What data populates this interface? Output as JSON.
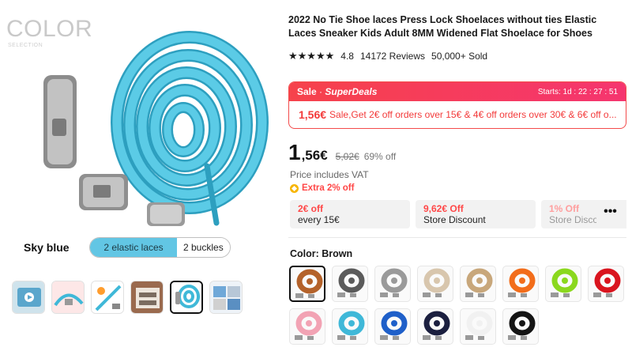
{
  "gallery": {
    "watermark_title": "COLOR",
    "watermark_sub": "SELECTION",
    "color_name": "Sky blue",
    "option_a": "2 elastic laces",
    "option_b": "2 buckles",
    "lace_color": "#40b9d8",
    "selected_thumb_index": 4
  },
  "product": {
    "title": "2022 No Tie Shoe laces Press Lock Shoelaces without ties Elastic Laces Sneaker Kids Adult 8MM Widened Flat Shoelace for Shoes",
    "rating": "4.8",
    "reviews": "14172 Reviews",
    "sold": "50,000+ Sold",
    "stars": "★★★★★"
  },
  "deal": {
    "sale": "Sale",
    "brand": "SuperDeals",
    "starts_label": "Starts: 1d : 22 : 27 : 51",
    "price": "1,56€",
    "text": "Sale,Get 2€ off orders over 15€ & 4€ off orders over 30€ & 6€ off o..."
  },
  "price": {
    "int": "1",
    "dec": ",56€",
    "old": "5,02€",
    "off": "69% off",
    "vat": "Price includes VAT",
    "extra": "Extra 2% off"
  },
  "coupons": [
    {
      "line1": "2€ off",
      "line2": "every 15€"
    },
    {
      "line1": "9,62€ Off",
      "line2": "Store Discount"
    },
    {
      "line1": "1% Off",
      "line2": "Store Discount"
    }
  ],
  "more_label": "•••",
  "color_label": "Color: Brown",
  "swatches": [
    {
      "name": "brown",
      "color": "#b4622a"
    },
    {
      "name": "dark-gray",
      "color": "#5b5b5b"
    },
    {
      "name": "gray",
      "color": "#9a9a9a"
    },
    {
      "name": "beige",
      "color": "#d8c6ad"
    },
    {
      "name": "khaki",
      "color": "#c8a77b"
    },
    {
      "name": "orange",
      "color": "#f26d1b"
    },
    {
      "name": "lime",
      "color": "#8bd81e"
    },
    {
      "name": "red",
      "color": "#d9141e"
    },
    {
      "name": "pink",
      "color": "#f2a3b4"
    },
    {
      "name": "sky-blue",
      "color": "#3fb8d8"
    },
    {
      "name": "royal-blue",
      "color": "#1e5fc9"
    },
    {
      "name": "navy",
      "color": "#1b1f3f"
    },
    {
      "name": "white",
      "color": "#f1f1f1"
    },
    {
      "name": "black",
      "color": "#141414"
    }
  ],
  "selected_swatch": 0
}
